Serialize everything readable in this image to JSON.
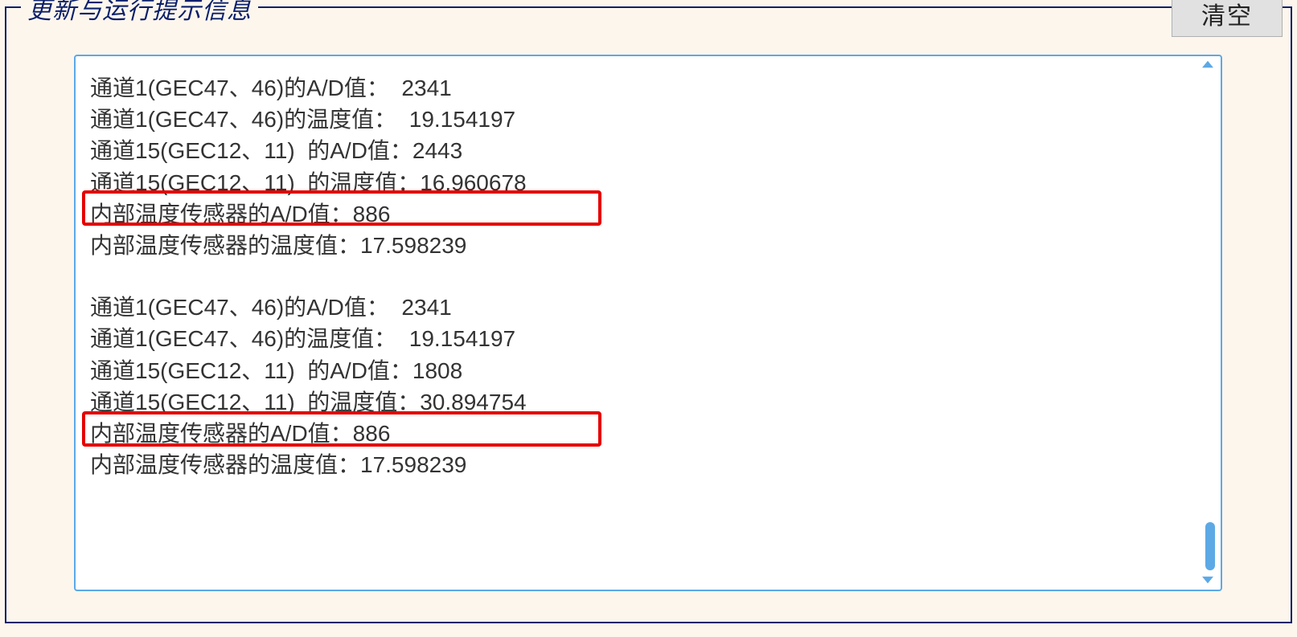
{
  "panel": {
    "title": "更新与运行提示信息",
    "clear_label": "清空"
  },
  "log": {
    "lines": [
      "通道1(GEC47、46)的A/D值：  2341",
      "通道1(GEC47、46)的温度值：  19.154197",
      "通道15(GEC12、11)  的A/D值：2443",
      "通道15(GEC12、11)  的温度值：16.960678",
      "内部温度传感器的A/D值：886",
      "内部温度传感器的温度值：17.598239",
      "",
      "通道1(GEC47、46)的A/D值：  2341",
      "通道1(GEC47、46)的温度值：  19.154197",
      "通道15(GEC12、11)  的A/D值：1808",
      "通道15(GEC12、11)  的温度值：30.894754",
      "内部温度传感器的A/D值：886",
      "内部温度传感器的温度值：17.598239"
    ]
  }
}
